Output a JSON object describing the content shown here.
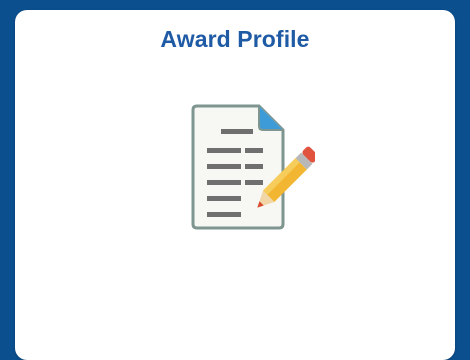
{
  "tile": {
    "title": "Award Profile",
    "icon": "document-edit-icon"
  },
  "colors": {
    "background": "#0b4f8f",
    "title": "#1f5aa5",
    "tile": "#ffffff"
  }
}
